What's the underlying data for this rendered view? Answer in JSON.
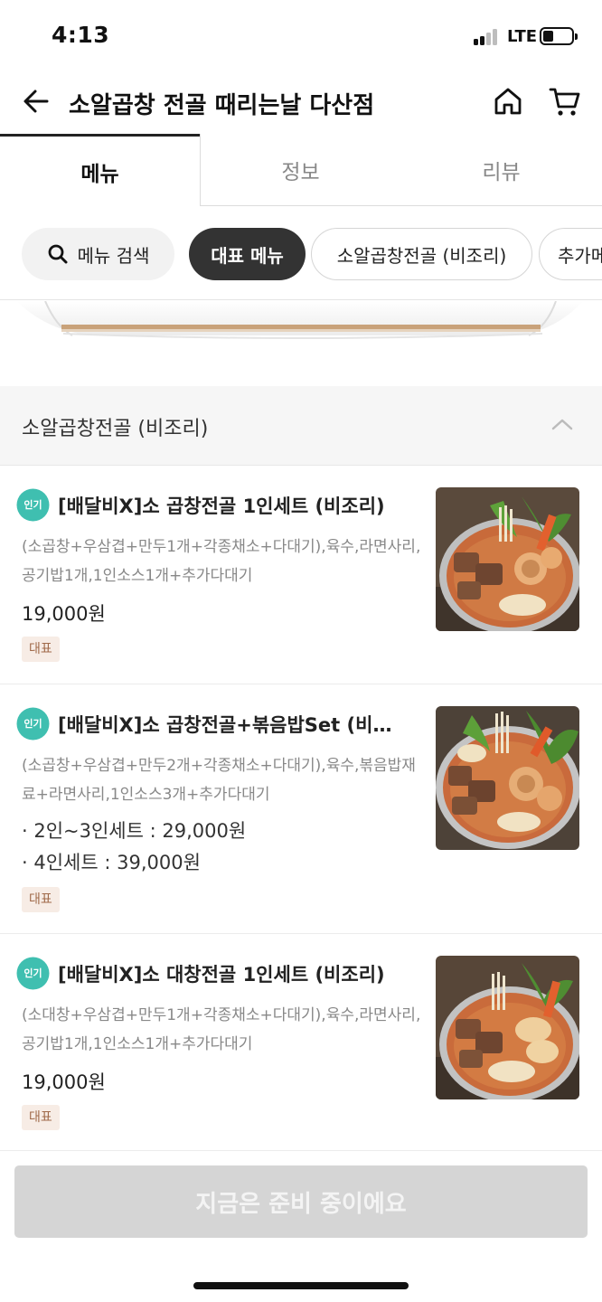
{
  "status_bar": {
    "time": "4:13",
    "network": "LTE"
  },
  "header": {
    "title": "소알곱창 전골 때리는날 다산점"
  },
  "tabs": [
    {
      "label": "메뉴"
    },
    {
      "label": "정보"
    },
    {
      "label": "리뷰"
    }
  ],
  "chips": {
    "search_label": "메뉴 검색",
    "items": [
      {
        "label": "대표 메뉴"
      },
      {
        "label": "소알곱창전골 (비조리)"
      },
      {
        "label": "추가메"
      }
    ]
  },
  "section": {
    "title": "소알곱창전골 (비조리)"
  },
  "menu_items": [
    {
      "badge": "인기",
      "name": "[배달비X]소 곱창전골 1인세트 (비조리)",
      "description": "(소곱창+우삼겹+만두1개+각종채소+다대기),육수,라면사리,공기밥1개,1인소스1개+추가다대기",
      "price": "19,000원",
      "tag": "대표"
    },
    {
      "badge": "인기",
      "name": "[배달비X]소 곱창전골+볶음밥Set (비…",
      "description": "(소곱창+우삼겹+만두2개+각종채소+다대기),육수,볶음밥재료+라면사리,1인소스3개+추가다대기",
      "options": [
        "· 2인~3인세트 : 29,000원",
        "· 4인세트 : 39,000원"
      ],
      "tag": "대표"
    },
    {
      "badge": "인기",
      "name": "[배달비X]소 대창전골 1인세트 (비조리)",
      "description": "(소대창+우삼겹+만두1개+각종채소+다대기),육수,라면사리,공기밥1개,1인소스1개+추가다대기",
      "price": "19,000원",
      "tag": "대표"
    }
  ],
  "bottom_button": {
    "label": "지금은 준비 중이에요"
  },
  "colors": {
    "active_chip": "#333333",
    "badge": "#3fbfb0",
    "tag_bg": "#f7ece5",
    "tag_text": "#a06a4a",
    "disabled_button": "#d5d5d5"
  },
  "icons": [
    "back-arrow-icon",
    "home-icon",
    "cart-icon",
    "search-icon",
    "chevron-up-icon"
  ]
}
